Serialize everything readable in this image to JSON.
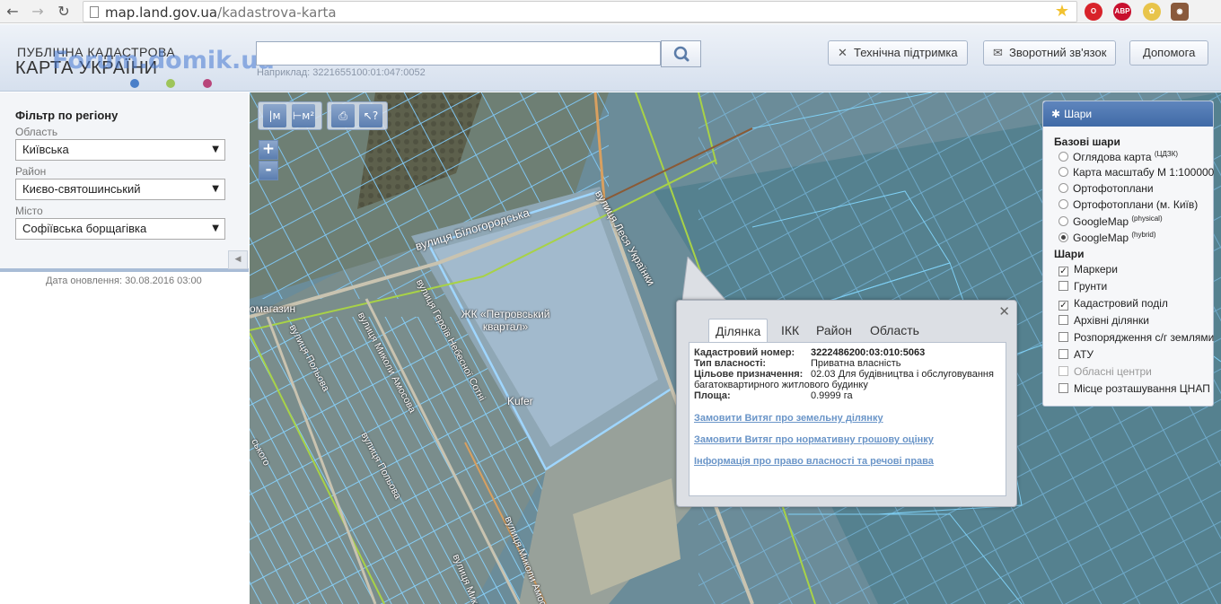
{
  "browser": {
    "url_host": "map.land.gov.ua",
    "url_path": "/kadastrova-karta",
    "back_icon": "←",
    "forward_icon": "→",
    "reload_icon": "↻",
    "ext_abp": "ABP"
  },
  "header": {
    "logo_line1": "ПУБЛІЧНА КАДАСТРОВА",
    "logo_line2": "КАРТА УКРАЇНИ",
    "watermark": "Forum.domik.ua",
    "search_placeholder": "",
    "search_hint": "Наприклад: 3221655100:01:047:0052",
    "buttons": {
      "support": "Технічна підтримка",
      "feedback": "Зворотний зв'язок",
      "help": "Допомога"
    },
    "colors": {
      "dot1": "#4a7fc9",
      "dot2": "#9ec55a",
      "dot3": "#b8457a"
    }
  },
  "sidebar": {
    "title": "Фільтр по регіону",
    "region_label": "Область",
    "region_value": "Київська",
    "district_label": "Район",
    "district_value": "Києво-святошинський",
    "city_label": "Місто",
    "city_value": "Софіївська борщагівка",
    "update_date": "Дата оновлення: 30.08.2016 03:00"
  },
  "map": {
    "tools": {
      "ruler": "|м",
      "area": "⊢м²",
      "print": "⎙",
      "info": "↖?"
    },
    "zoom_in": "+",
    "zoom_out": "-",
    "labels": {
      "street1": "вулиця Білогородська",
      "street2": "вулиця Леся Українки",
      "street3": "вулиця Героїв Небесної Сотні",
      "street4": "вулиця Миколи Амосова",
      "street5": "вулиця Польова",
      "street6": "вулиця Польова",
      "street7": "вулиця Миколи Амосова",
      "complex": "ЖК «Петровський квартал»",
      "kufer": "Kufer",
      "shop": "омагазин",
      "street_edge": "ського",
      "street_bottom": "вулиця Миколи"
    }
  },
  "popup": {
    "tabs": [
      "Ділянка",
      "ІКК",
      "Район",
      "Область"
    ],
    "active_tab": "Ділянка",
    "cadastral_label": "Кадастровий номер:",
    "cadastral_value": "3222486200:03:010:5063",
    "ownership_label": "Тип власності:",
    "ownership_value": "Приватна власність",
    "purpose_label": "Цільове призначення:",
    "purpose_value_1": "02.03 Для будівництва і обслуговування",
    "purpose_value_2": "багатоквартирного житлового будинку",
    "area_label": "Площа:",
    "area_value": "0.9999 га",
    "link1": "Замовити Витяг про земельну ділянку",
    "link2": "Замовити Витяг про нормативну грошову оцінку",
    "link3": "Інформація про право власності та речові права"
  },
  "layers": {
    "title": "Шари",
    "base_title": "Базові шари",
    "base": [
      {
        "label": "Оглядова карта",
        "sup": "(ЦДЗК)",
        "checked": false
      },
      {
        "label": "Карта масштабу М 1:100000",
        "sup": "",
        "checked": false
      },
      {
        "label": "Ортофотоплани",
        "sup": "",
        "checked": false
      },
      {
        "label": "Ортофотоплани (м. Київ)",
        "sup": "",
        "checked": false
      },
      {
        "label": "GoogleMap",
        "sup": "(physical)",
        "checked": false
      },
      {
        "label": "GoogleMap",
        "sup": "(hybrid)",
        "checked": true
      }
    ],
    "overlay_title": "Шари",
    "overlays": [
      {
        "label": "Маркери",
        "checked": true,
        "dim": false
      },
      {
        "label": "Грунти",
        "checked": false,
        "dim": false
      },
      {
        "label": "Кадастровий поділ",
        "checked": true,
        "dim": false
      },
      {
        "label": "Архівні ділянки",
        "checked": false,
        "dim": false
      },
      {
        "label": "Розпорядження с/г землями",
        "checked": false,
        "dim": false
      },
      {
        "label": "АТУ",
        "checked": false,
        "dim": false
      },
      {
        "label": "Обласні центри",
        "checked": false,
        "dim": true
      },
      {
        "label": "Місце розташування ЦНАП",
        "checked": false,
        "dim": false
      }
    ]
  }
}
